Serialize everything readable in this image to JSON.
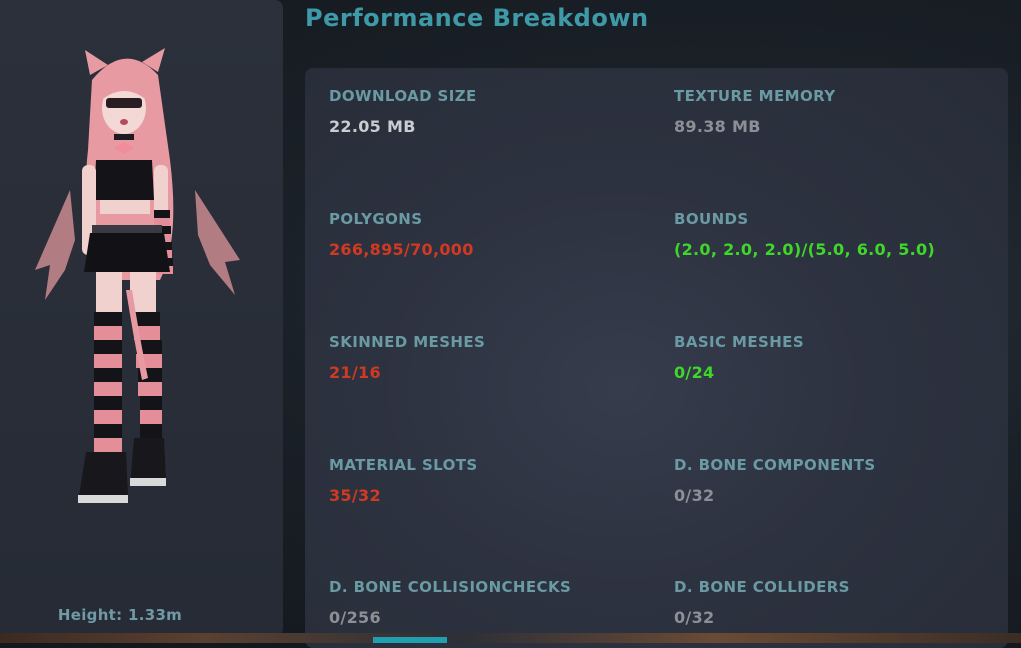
{
  "title": "Performance Breakdown",
  "avatar": {
    "height_label": "Height: 1.33m"
  },
  "colors": {
    "title": "#3f9aa8",
    "label": "#6a9aa3",
    "ok_value": "#c9ccd1",
    "neutral_value": "#8c9096",
    "over_limit": "#d03a22",
    "within_limit": "#3fd72a"
  },
  "stats": [
    {
      "label": "DOWNLOAD SIZE",
      "value": "22.05 MB",
      "status": "white"
    },
    {
      "label": "TEXTURE MEMORY",
      "value": "89.38 MB",
      "status": "grey"
    },
    {
      "label": "POLYGONS",
      "value": "266,895/70,000",
      "status": "red"
    },
    {
      "label": "BOUNDS",
      "value": "(2.0, 2.0, 2.0)/(5.0, 6.0, 5.0)",
      "status": "green"
    },
    {
      "label": "SKINNED MESHES",
      "value": "21/16",
      "status": "red"
    },
    {
      "label": "BASIC MESHES",
      "value": "0/24",
      "status": "green"
    },
    {
      "label": "MATERIAL SLOTS",
      "value": "35/32",
      "status": "red"
    },
    {
      "label": "D. BONE COMPONENTS",
      "value": "0/32",
      "status": "grey"
    },
    {
      "label": "D. BONE COLLISIONCHECKS",
      "value": "0/256",
      "status": "grey"
    },
    {
      "label": "D. BONE COLLIDERS",
      "value": "0/32",
      "status": "grey"
    }
  ]
}
